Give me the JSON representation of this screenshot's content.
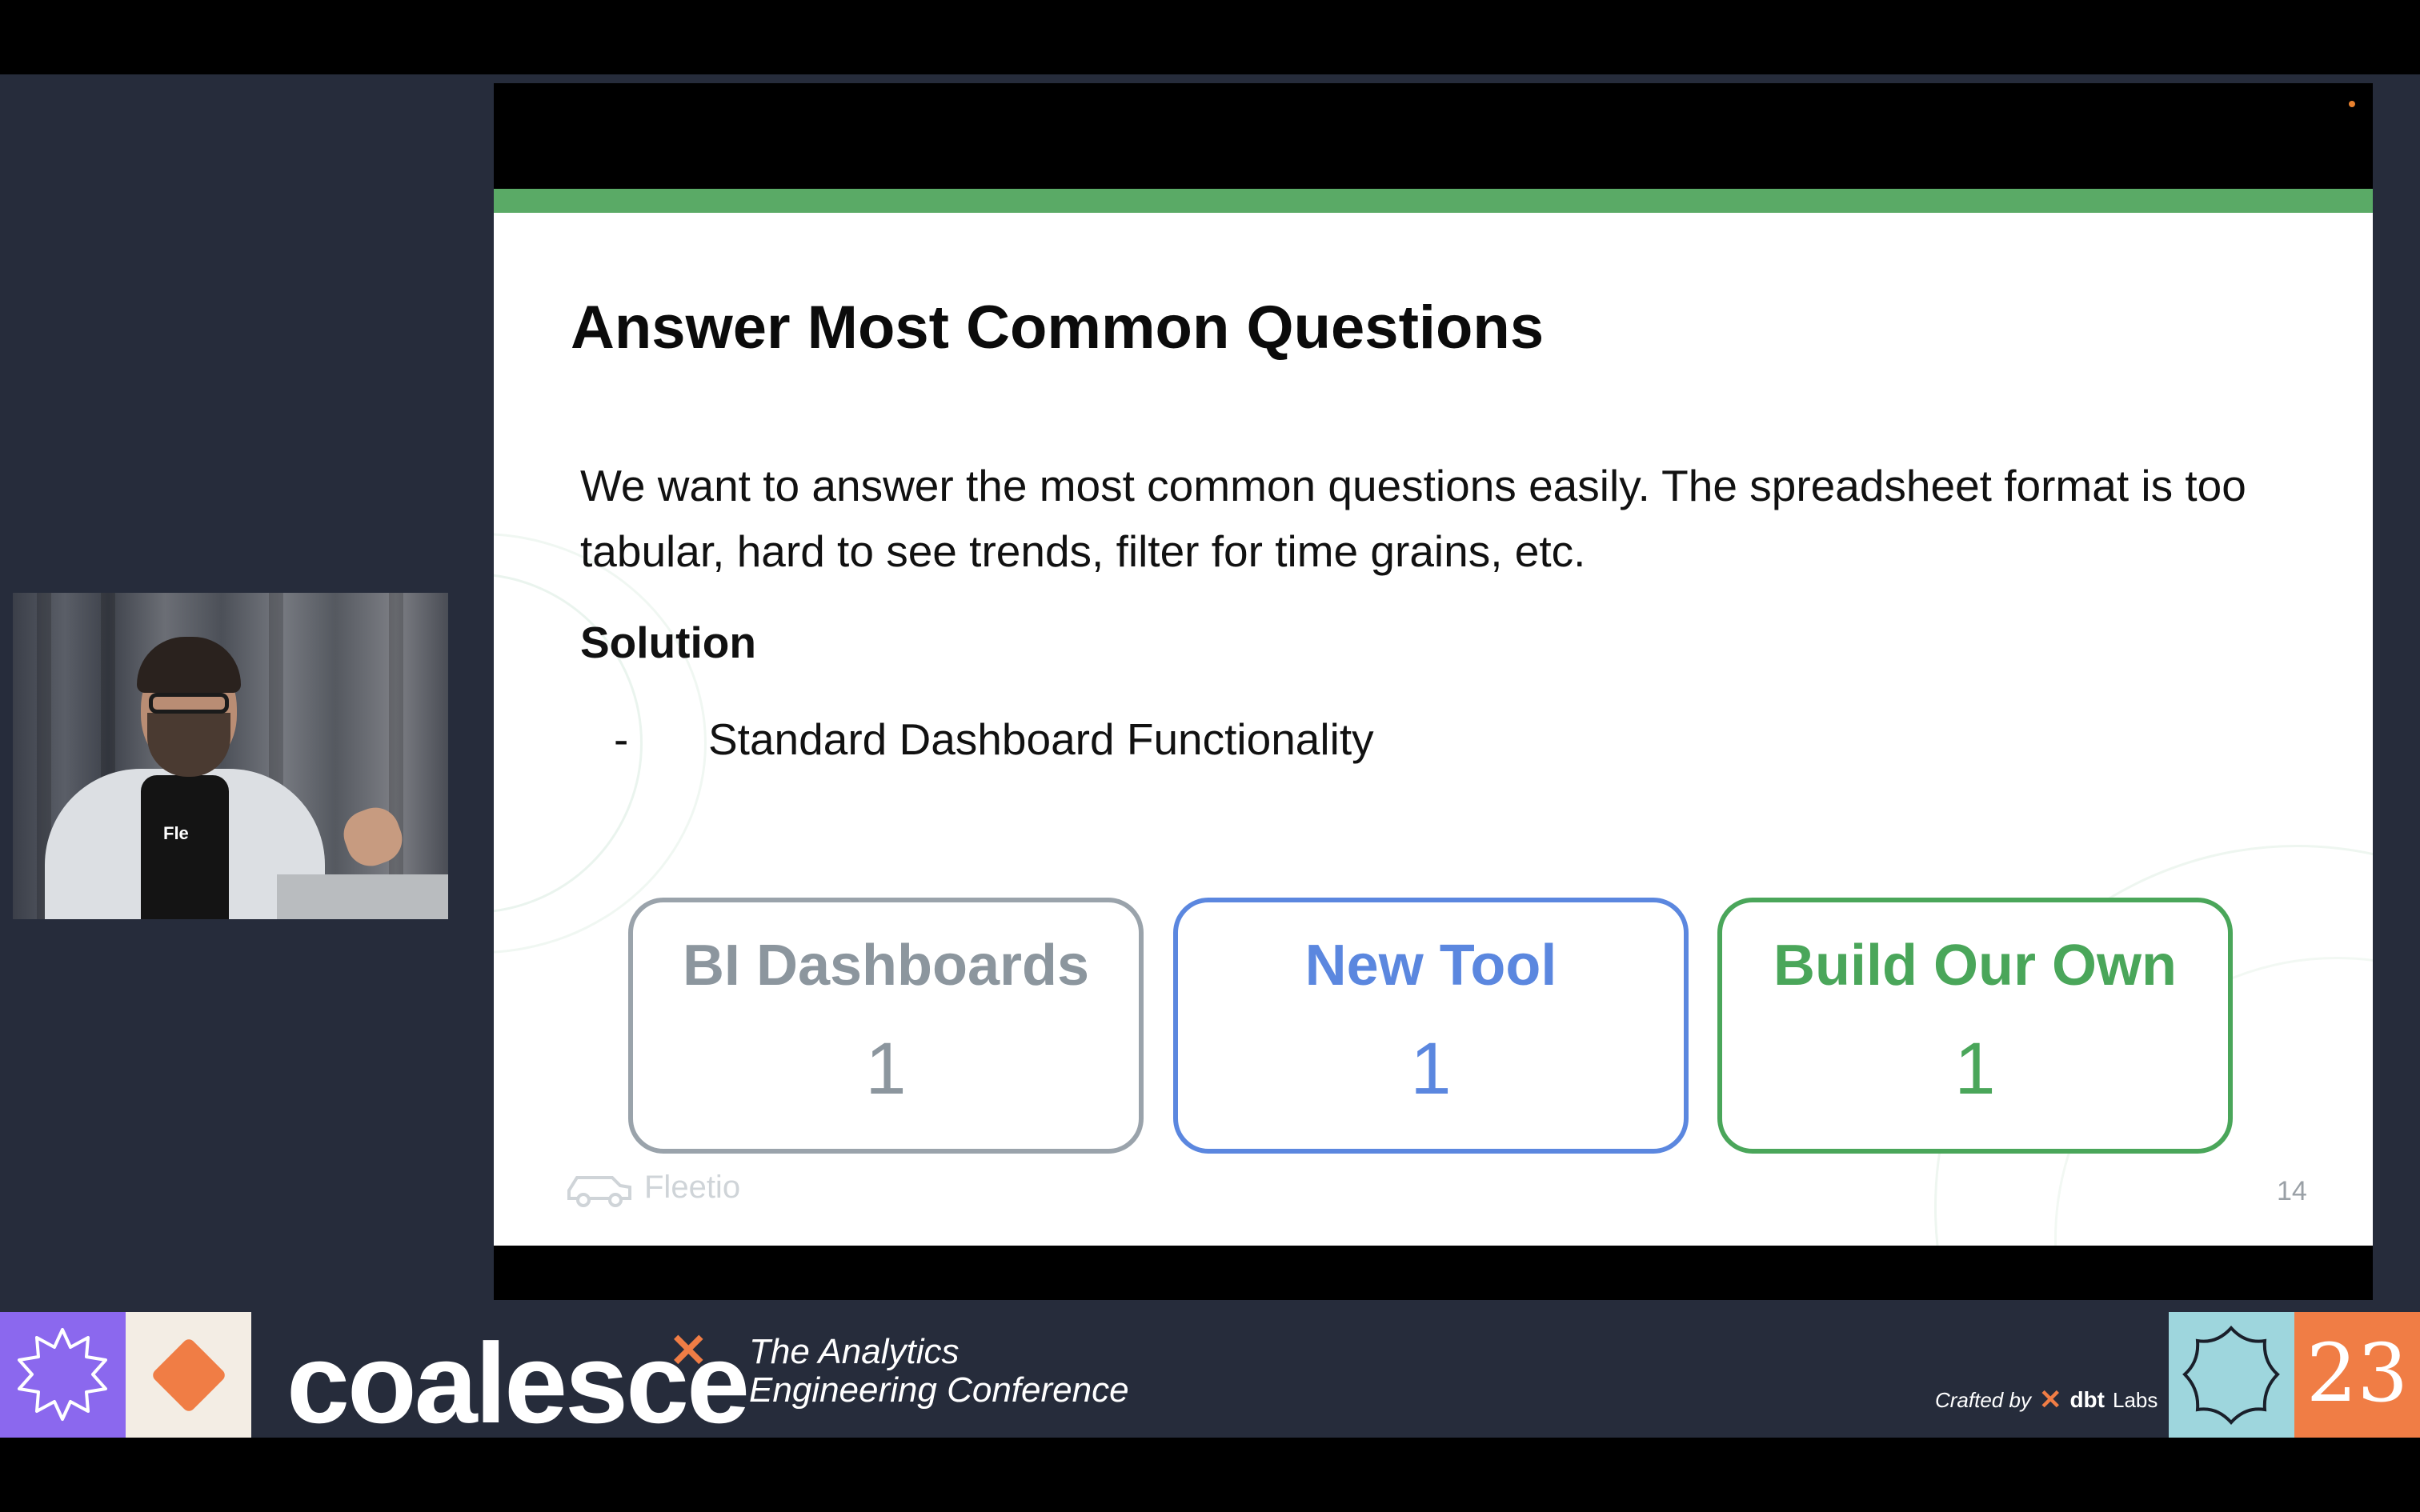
{
  "slide": {
    "title": "Answer Most Common Questions",
    "body": "We want to answer the most common questions easily. The spreadsheet format is too tabular, hard to see trends, filter for time grains, etc.",
    "subheading": "Solution",
    "bullets": [
      {
        "marker": "-",
        "text": "Standard Dashboard Functionality"
      }
    ],
    "cards": [
      {
        "title": "BI Dashboards",
        "count": "1",
        "color": "#8c969e"
      },
      {
        "title": "New Tool",
        "count": "1",
        "color": "#5b87df"
      },
      {
        "title": "Build Our Own",
        "count": "1",
        "color": "#4aa65a"
      }
    ],
    "logo_text": "Fleetio",
    "page_number": "14",
    "accent_color": "#5aaa66"
  },
  "event": {
    "brand": "coalesce",
    "tagline_line1": "The Analytics",
    "tagline_line2": "Engineering Conference",
    "crafted_by": "Crafted by",
    "sponsor": "dbt",
    "sponsor_suffix": "Labs",
    "year": "23"
  },
  "camera": {
    "shirt_text": "Fle"
  }
}
